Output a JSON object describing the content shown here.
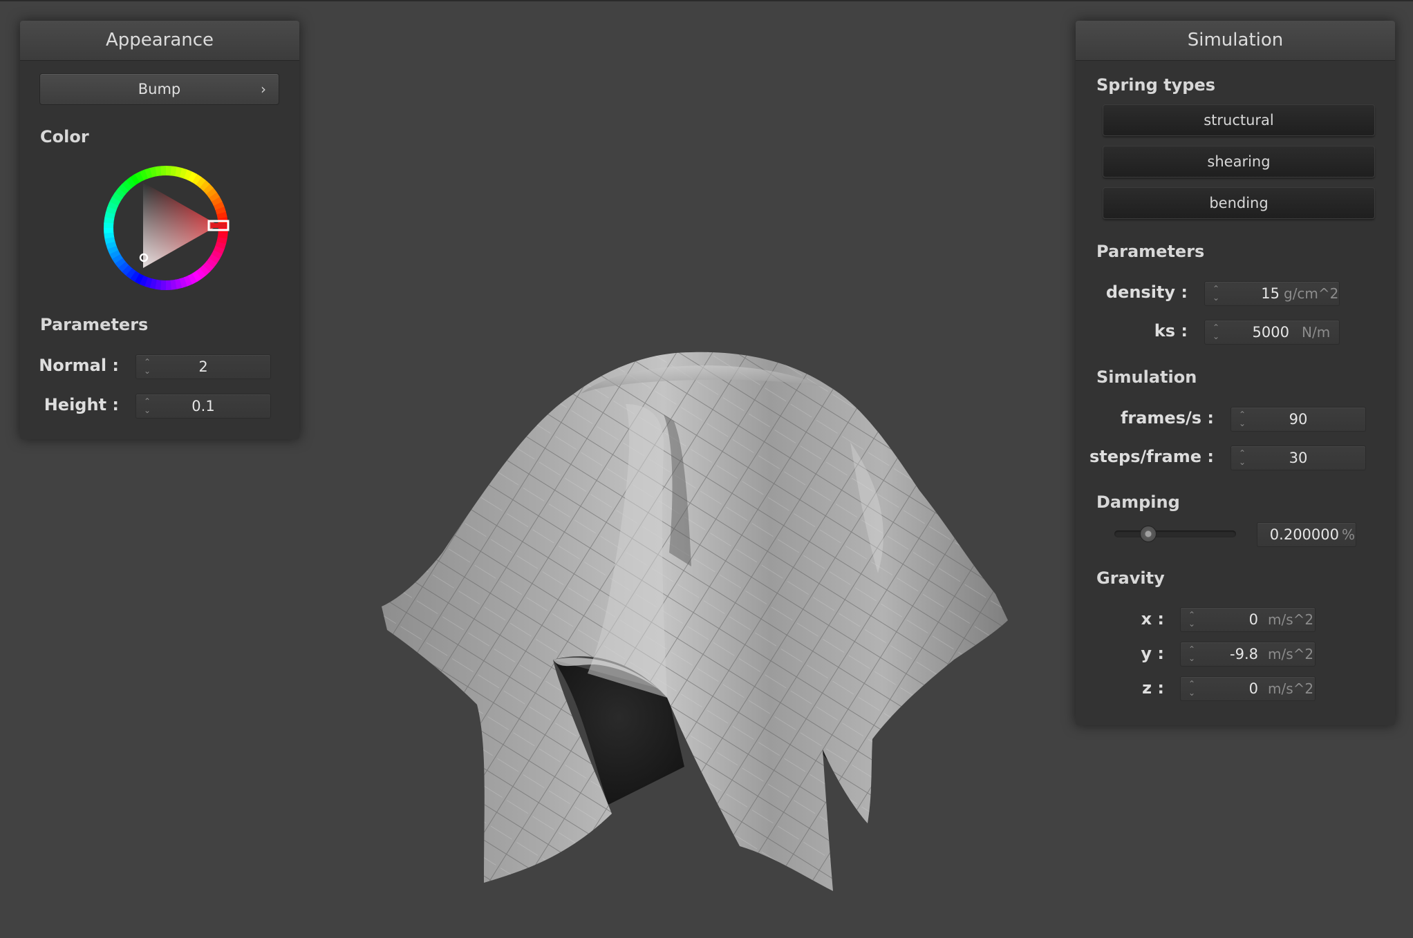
{
  "appearance": {
    "title": "Appearance",
    "texture_dropdown": "Bump",
    "color_label": "Color",
    "selected_color": "#e0191f",
    "parameters_label": "Parameters",
    "normal_label": "Normal :",
    "normal_value": "2",
    "height_label": "Height :",
    "height_value": "0.1"
  },
  "simulation": {
    "title": "Simulation",
    "spring_types_label": "Spring types",
    "spring_buttons": [
      "structural",
      "shearing",
      "bending"
    ],
    "parameters_label": "Parameters",
    "density_label": "density :",
    "density_value": "15",
    "density_unit": "g/cm^2",
    "ks_label": "ks :",
    "ks_value": "5000",
    "ks_unit": "N/m",
    "simulation_label": "Simulation",
    "fps_label": "frames/s :",
    "fps_value": "90",
    "steps_label": "steps/frame :",
    "steps_value": "30",
    "damping_label": "Damping",
    "damping_value": "0.200000",
    "damping_unit": "%",
    "damping_level": 0.2,
    "gravity_label": "Gravity",
    "gx_label": "x :",
    "gx_value": "0",
    "gy_label": "y :",
    "gy_value": "-9.8",
    "gz_label": "z :",
    "gz_value": "0",
    "gravity_unit": "m/s^2"
  },
  "icons": {
    "spinner": "up-down-spinner-icon",
    "dropdown": "chevron-right-icon",
    "color_wheel": "hue-wheel-icon"
  }
}
